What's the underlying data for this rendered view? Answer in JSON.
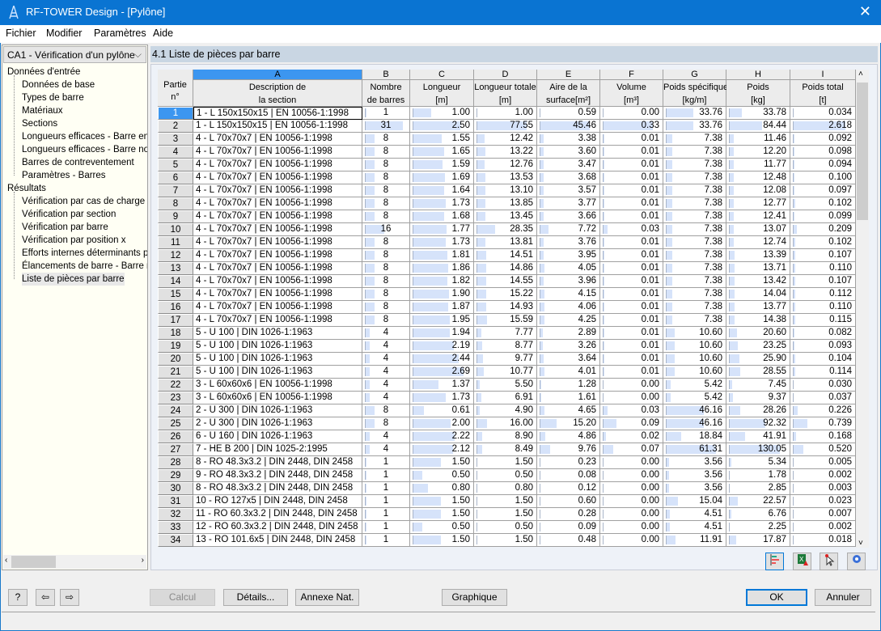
{
  "window": {
    "title": "RF-TOWER Design - [Pylône]",
    "close_icon": "close-icon"
  },
  "menu": [
    "Fichier",
    "Modifier",
    "Paramètres",
    "Aide"
  ],
  "case_selector": {
    "value": "CA1 - Vérification d'un pylône"
  },
  "tree": {
    "input_label": "Données d'entrée",
    "input_items": [
      "Données de base",
      "Types de barre",
      "Matériaux",
      "Sections",
      "Longueurs efficaces - Barre en t",
      "Longueurs efficaces - Barre non",
      "Barres de contreventement",
      "Paramètres - Barres"
    ],
    "results_label": "Résultats",
    "results_items": [
      "Vérification par cas de charge",
      "Vérification par section",
      "Vérification par barre",
      "Vérification par position x",
      "Efforts internes déterminants pa",
      "Élancements de barre - Barre no",
      "Liste de pièces par barre"
    ],
    "selected": "Liste de pièces par barre"
  },
  "section_title": "4.1 Liste de pièces par barre",
  "table": {
    "rowhead": "Partie\nn°",
    "columns": [
      {
        "letter": "A",
        "label": "Description de\nla section"
      },
      {
        "letter": "B",
        "label": "Nombre\nde barres"
      },
      {
        "letter": "C",
        "label": "Longueur\n[m]"
      },
      {
        "letter": "D",
        "label": "Longueur totale\n[m]"
      },
      {
        "letter": "E",
        "label": "Aire de la\nsurface[m²]"
      },
      {
        "letter": "F",
        "label": "Volume\n[m³]"
      },
      {
        "letter": "G",
        "label": "Poids spécifique\n[kg/m]"
      },
      {
        "letter": "H",
        "label": "Poids\n[kg]"
      },
      {
        "letter": "I",
        "label": "Poids total\n[t]"
      }
    ],
    "selected_row": "1",
    "rows": [
      [
        "1",
        "1 - L 150x150x15 | EN 10056-1:1998",
        "1",
        "1.00",
        "1.00",
        "0.59",
        "0.00",
        "33.76",
        "33.78",
        "0.034"
      ],
      [
        "2",
        "1 - L 150x150x15 | EN 10056-1:1998",
        "31",
        "2.50",
        "77.55",
        "45.46",
        "0.33",
        "33.76",
        "84.44",
        "2.618"
      ],
      [
        "3",
        "4 - L 70x70x7 | EN 10056-1:1998",
        "8",
        "1.55",
        "12.42",
        "3.38",
        "0.01",
        "7.38",
        "11.46",
        "0.092"
      ],
      [
        "4",
        "4 - L 70x70x7 | EN 10056-1:1998",
        "8",
        "1.65",
        "13.22",
        "3.60",
        "0.01",
        "7.38",
        "12.20",
        "0.098"
      ],
      [
        "5",
        "4 - L 70x70x7 | EN 10056-1:1998",
        "8",
        "1.59",
        "12.76",
        "3.47",
        "0.01",
        "7.38",
        "11.77",
        "0.094"
      ],
      [
        "6",
        "4 - L 70x70x7 | EN 10056-1:1998",
        "8",
        "1.69",
        "13.53",
        "3.68",
        "0.01",
        "7.38",
        "12.48",
        "0.100"
      ],
      [
        "7",
        "4 - L 70x70x7 | EN 10056-1:1998",
        "8",
        "1.64",
        "13.10",
        "3.57",
        "0.01",
        "7.38",
        "12.08",
        "0.097"
      ],
      [
        "8",
        "4 - L 70x70x7 | EN 10056-1:1998",
        "8",
        "1.73",
        "13.85",
        "3.77",
        "0.01",
        "7.38",
        "12.77",
        "0.102"
      ],
      [
        "9",
        "4 - L 70x70x7 | EN 10056-1:1998",
        "8",
        "1.68",
        "13.45",
        "3.66",
        "0.01",
        "7.38",
        "12.41",
        "0.099"
      ],
      [
        "10",
        "4 - L 70x70x7 | EN 10056-1:1998",
        "16",
        "1.77",
        "28.35",
        "7.72",
        "0.03",
        "7.38",
        "13.07",
        "0.209"
      ],
      [
        "11",
        "4 - L 70x70x7 | EN 10056-1:1998",
        "8",
        "1.73",
        "13.81",
        "3.76",
        "0.01",
        "7.38",
        "12.74",
        "0.102"
      ],
      [
        "12",
        "4 - L 70x70x7 | EN 10056-1:1998",
        "8",
        "1.81",
        "14.51",
        "3.95",
        "0.01",
        "7.38",
        "13.39",
        "0.107"
      ],
      [
        "13",
        "4 - L 70x70x7 | EN 10056-1:1998",
        "8",
        "1.86",
        "14.86",
        "4.05",
        "0.01",
        "7.38",
        "13.71",
        "0.110"
      ],
      [
        "14",
        "4 - L 70x70x7 | EN 10056-1:1998",
        "8",
        "1.82",
        "14.55",
        "3.96",
        "0.01",
        "7.38",
        "13.42",
        "0.107"
      ],
      [
        "15",
        "4 - L 70x70x7 | EN 10056-1:1998",
        "8",
        "1.90",
        "15.22",
        "4.15",
        "0.01",
        "7.38",
        "14.04",
        "0.112"
      ],
      [
        "16",
        "4 - L 70x70x7 | EN 10056-1:1998",
        "8",
        "1.87",
        "14.93",
        "4.06",
        "0.01",
        "7.38",
        "13.77",
        "0.110"
      ],
      [
        "17",
        "4 - L 70x70x7 | EN 10056-1:1998",
        "8",
        "1.95",
        "15.59",
        "4.25",
        "0.01",
        "7.38",
        "14.38",
        "0.115"
      ],
      [
        "18",
        "5 - U 100 | DIN 1026-1:1963",
        "4",
        "1.94",
        "7.77",
        "2.89",
        "0.01",
        "10.60",
        "20.60",
        "0.082"
      ],
      [
        "19",
        "5 - U 100 | DIN 1026-1:1963",
        "4",
        "2.19",
        "8.77",
        "3.26",
        "0.01",
        "10.60",
        "23.25",
        "0.093"
      ],
      [
        "20",
        "5 - U 100 | DIN 1026-1:1963",
        "4",
        "2.44",
        "9.77",
        "3.64",
        "0.01",
        "10.60",
        "25.90",
        "0.104"
      ],
      [
        "21",
        "5 - U 100 | DIN 1026-1:1963",
        "4",
        "2.69",
        "10.77",
        "4.01",
        "0.01",
        "10.60",
        "28.55",
        "0.114"
      ],
      [
        "22",
        "3 - L 60x60x6 | EN 10056-1:1998",
        "4",
        "1.37",
        "5.50",
        "1.28",
        "0.00",
        "5.42",
        "7.45",
        "0.030"
      ],
      [
        "23",
        "3 - L 60x60x6 | EN 10056-1:1998",
        "4",
        "1.73",
        "6.91",
        "1.61",
        "0.00",
        "5.42",
        "9.37",
        "0.037"
      ],
      [
        "24",
        "2 - U 300 | DIN 1026-1:1963",
        "8",
        "0.61",
        "4.90",
        "4.65",
        "0.03",
        "46.16",
        "28.26",
        "0.226"
      ],
      [
        "25",
        "2 - U 300 | DIN 1026-1:1963",
        "8",
        "2.00",
        "16.00",
        "15.20",
        "0.09",
        "46.16",
        "92.32",
        "0.739"
      ],
      [
        "26",
        "6 - U 160 | DIN 1026-1:1963",
        "4",
        "2.22",
        "8.90",
        "4.86",
        "0.02",
        "18.84",
        "41.91",
        "0.168"
      ],
      [
        "27",
        "7 - HE B 200 | DIN 1025-2:1995",
        "4",
        "2.12",
        "8.49",
        "9.76",
        "0.07",
        "61.31",
        "130.05",
        "0.520"
      ],
      [
        "28",
        "8 - RO 48.3x3.2 | DIN 2448, DIN 2458",
        "1",
        "1.50",
        "1.50",
        "0.23",
        "0.00",
        "3.56",
        "5.34",
        "0.005"
      ],
      [
        "29",
        "9 - RO 48.3x3.2 | DIN 2448, DIN 2458",
        "1",
        "0.50",
        "0.50",
        "0.08",
        "0.00",
        "3.56",
        "1.78",
        "0.002"
      ],
      [
        "30",
        "8 - RO 48.3x3.2 | DIN 2448, DIN 2458",
        "1",
        "0.80",
        "0.80",
        "0.12",
        "0.00",
        "3.56",
        "2.85",
        "0.003"
      ],
      [
        "31",
        "10 - RO 127x5 | DIN 2448, DIN 2458",
        "1",
        "1.50",
        "1.50",
        "0.60",
        "0.00",
        "15.04",
        "22.57",
        "0.023"
      ],
      [
        "32",
        "11 - RO 60.3x3.2 | DIN 2448, DIN 2458",
        "1",
        "1.50",
        "1.50",
        "0.28",
        "0.00",
        "4.51",
        "6.76",
        "0.007"
      ],
      [
        "33",
        "12 - RO 60.3x3.2 | DIN 2448, DIN 2458",
        "1",
        "0.50",
        "0.50",
        "0.09",
        "0.00",
        "4.51",
        "2.25",
        "0.002"
      ],
      [
        "34",
        "13 - RO 101.6x5 | DIN 2448, DIN 2458",
        "1",
        "1.50",
        "1.50",
        "0.48",
        "0.00",
        "11.91",
        "17.87",
        "0.018"
      ]
    ]
  },
  "table_toolbar": [
    {
      "icon": "bar-chart-icon"
    },
    {
      "icon": "excel-export-icon"
    },
    {
      "icon": "select-pointer-icon"
    },
    {
      "icon": "eye-icon"
    }
  ],
  "buttons": {
    "help_icon": "help-icon",
    "prev_icon": "previous-icon",
    "next_icon": "next-icon",
    "calcul": "Calcul",
    "details": "Détails...",
    "annexe": "Annexe Nat. ...",
    "graphique": "Graphique",
    "ok": "OK",
    "annuler": "Annuler"
  },
  "colors": {
    "titlebar": "#0a74d2",
    "bar_fill": "#d6e3fa",
    "selected_row": "#3c96f0"
  }
}
